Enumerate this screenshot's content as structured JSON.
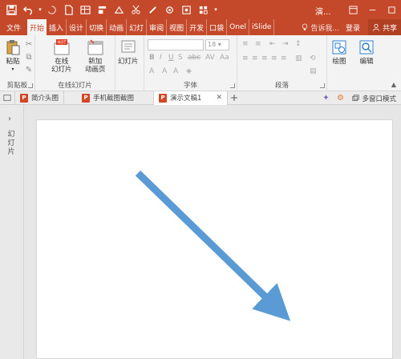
{
  "title": "演...",
  "tabs": [
    "文件",
    "开始",
    "插入",
    "设计",
    "切换",
    "动画",
    "幻灯",
    "审阅",
    "视图",
    "开发",
    "口袋",
    "Onel",
    "iSlide"
  ],
  "tell_me": "告诉我...",
  "sign_in": "登录",
  "share": "共享",
  "ribbon": {
    "paste": "粘贴",
    "clipboard": "剪贴板",
    "online_slide": "在线",
    "online_slide2": "幻灯片",
    "new_anim": "新加",
    "new_anim2": "动画页",
    "online_slides_group": "在线幻灯片",
    "slides_btn": "幻灯片",
    "font_size": "18",
    "font_group": "字体",
    "paragraph_group": "段落",
    "draw": "绘图",
    "edit": "编辑"
  },
  "doc_tabs": {
    "tab1": "简介头图",
    "tab2": "手机截图截图",
    "tab3": "演示文稿1",
    "multi_window": "多窗口模式"
  },
  "left_panel_label": "幻灯片",
  "colors": {
    "accent": "#c4492a",
    "arrow": "#5b9bd5"
  },
  "icons": [
    "save-icon",
    "undo-icon",
    "redo-icon",
    "new-file-icon",
    "table-icon",
    "paste-icon",
    "arrow-icon",
    "share-icon",
    "search-icon",
    "close-icon",
    "plus-icon"
  ]
}
